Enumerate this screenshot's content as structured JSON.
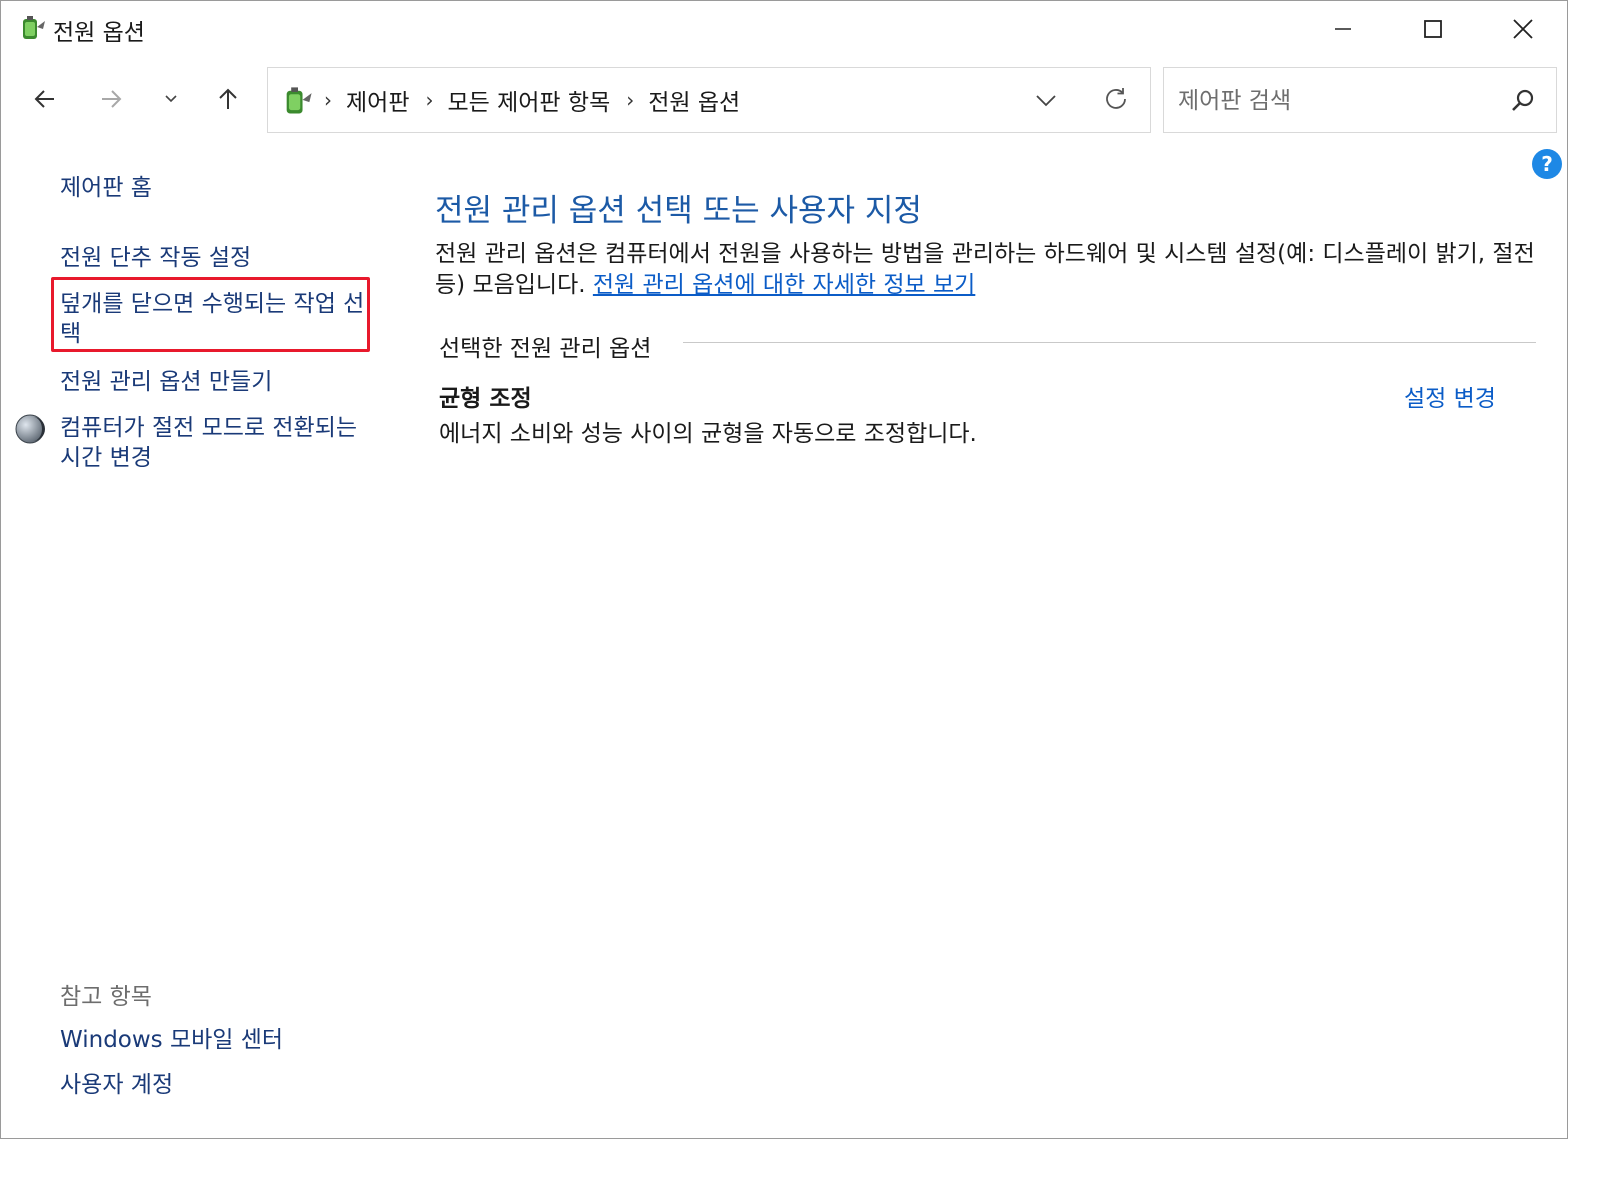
{
  "window": {
    "title": "전원 옵션"
  },
  "address_bar": {
    "crumbs": [
      "제어판",
      "모든 제어판 항목",
      "전원 옵션"
    ],
    "separator": "›"
  },
  "search": {
    "placeholder": "제어판 검색"
  },
  "help": {
    "label": "?"
  },
  "sidebar": {
    "home": "제어판 홈",
    "links": [
      "전원 단추 작동 설정",
      "덮개를 닫으면 수행되는 작업 선택",
      "전원 관리 옵션 만들기",
      "컴퓨터가 절전 모드로 전환되는 시간 변경"
    ],
    "see_also_heading": "참고 항목",
    "see_also": [
      "Windows 모바일 센터",
      "사용자 계정"
    ]
  },
  "main": {
    "title": "전원 관리 옵션 선택 또는 사용자 지정",
    "description": "전원 관리 옵션은 컴퓨터에서 전원을 사용하는 방법을 관리하는 하드웨어 및 시스템 설정(예: 디스플레이 밝기, 절전 등) 모음입니다. ",
    "description_link": "전원 관리 옵션에 대한 자세한 정보 보기",
    "section_label": "선택한 전원 관리 옵션",
    "plan": {
      "name": "균형 조정",
      "change_link": "설정 변경",
      "description": "에너지 소비와 성능 사이의 균형을 자동으로 조정합니다."
    }
  },
  "colors": {
    "highlight": "#e8192c",
    "link": "#0b5cc7",
    "title": "#1c5aa6",
    "help": "#1e88e5"
  }
}
